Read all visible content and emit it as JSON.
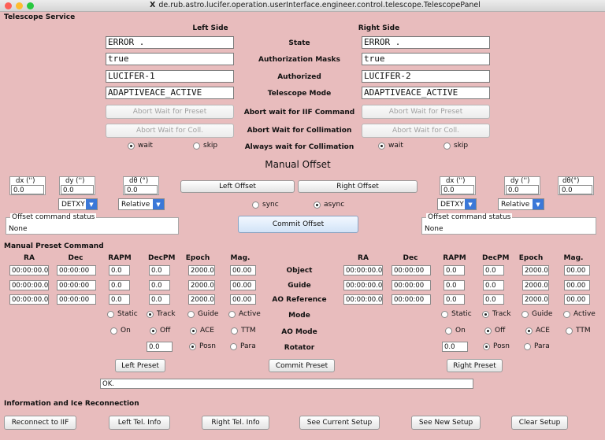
{
  "window": {
    "title": "de.rub.astro.lucifer.operation.userInterface.engineer.control.telescope.TelescopePanel",
    "x_glyph": "X"
  },
  "telescope_service": {
    "section_title": "Telescope Service",
    "left_header": "Left Side",
    "right_header": "Right Side",
    "rows": {
      "state": {
        "label": "State",
        "left": "ERROR  .",
        "right": "ERROR  ."
      },
      "auth_masks": {
        "label": "Authorization Masks",
        "left": "true",
        "right": "true"
      },
      "authorized": {
        "label": "Authorized",
        "left": "LUCIFER-1",
        "right": "LUCIFER-2"
      },
      "telescope_mode": {
        "label": "Telescope Mode",
        "left": "ADAPTIVEACE_ACTIVE",
        "right": "ADAPTIVEACE_ACTIVE"
      },
      "abort_iif": {
        "label": "Abort wait for IIF Command",
        "left": "Abort Wait for Preset",
        "right": "Abort Wait for Preset"
      },
      "abort_coll": {
        "label": "Abort Wait for Collimation",
        "left": "Abort Wait for Coll.",
        "right": "Abort Wait for Coll."
      },
      "always_wait": {
        "label": "Always wait for Collimation",
        "wait": "wait",
        "skip": "skip"
      }
    }
  },
  "manual_offset": {
    "title": "Manual Offset",
    "dx_label": "dx ('')",
    "dy_label": "dy ('')",
    "dtheta_label": "dθ (°)",
    "dtheta_label_right": "dθ(°)",
    "left": {
      "dx": "0.0",
      "dy": "0.0",
      "dtheta": "0.0",
      "frame": "DETXY",
      "mode": "Relative"
    },
    "right": {
      "dx": "0.0",
      "dy": "0.0",
      "dtheta": "0.0",
      "frame": "DETXY",
      "mode": "Relative"
    },
    "left_offset_button": "Left Offset",
    "right_offset_button": "Right Offset",
    "sync": "sync",
    "async": "async",
    "commit_button": "Commit Offset",
    "status_legend": "Offset command status",
    "left_status": "None",
    "right_status": "None"
  },
  "manual_preset": {
    "section_title": "Manual Preset Command",
    "columns": [
      "RA",
      "Dec",
      "RAPM",
      "DecPM",
      "Epoch",
      "Mag."
    ],
    "rows": [
      {
        "label": "Object",
        "left": [
          "00:00:00.0",
          "00:00:00",
          "0.0",
          "0.0",
          "2000.0",
          "00.00"
        ],
        "right": [
          "00:00:00.0",
          "00:00:00",
          "0.0",
          "0.0",
          "2000.0",
          "00.00"
        ]
      },
      {
        "label": "Guide",
        "left": [
          "00:00:00.0",
          "00:00:00",
          "0.0",
          "0.0",
          "2000.0",
          "00.00"
        ],
        "right": [
          "00:00:00.0",
          "00:00:00",
          "0.0",
          "0.0",
          "2000.0",
          "00.00"
        ]
      },
      {
        "label": "AO Reference",
        "left": [
          "00:00:00.0",
          "00:00:00",
          "0.0",
          "0.0",
          "2000.0",
          "00.00"
        ],
        "right": [
          "00:00:00.0",
          "00:00:00",
          "0.0",
          "0.0",
          "2000.0",
          "00.00"
        ]
      }
    ],
    "mode_label": "Mode",
    "mode_options": [
      "Static",
      "Track",
      "Guide",
      "Active"
    ],
    "ao_mode_label": "AO Mode",
    "ao_options": [
      "On",
      "Off",
      "ACE",
      "TTM"
    ],
    "rotator_label": "Rotator",
    "rotator_left": "0.0",
    "rotator_right": "0.0",
    "rotator_options": [
      "Posn",
      "Para"
    ],
    "left_preset_button": "Left Preset",
    "commit_preset_button": "Commit Preset",
    "right_preset_button": "Right Preset",
    "status_text": "OK."
  },
  "info": {
    "section_title": "Information and Ice Reconnection",
    "buttons": {
      "reconnect": "Reconnect to IIF",
      "left_info": "Left Tel. Info",
      "right_info": "Right Tel. Info",
      "current_setup": "See Current Setup",
      "new_setup": "See New Setup",
      "clear_setup": "Clear Setup"
    }
  },
  "colors": {
    "background": "#e8bcbd",
    "select_arrow": "#3b78d8",
    "close": "#fd5f57",
    "minimize": "#febc2e",
    "zoom": "#28c840"
  }
}
